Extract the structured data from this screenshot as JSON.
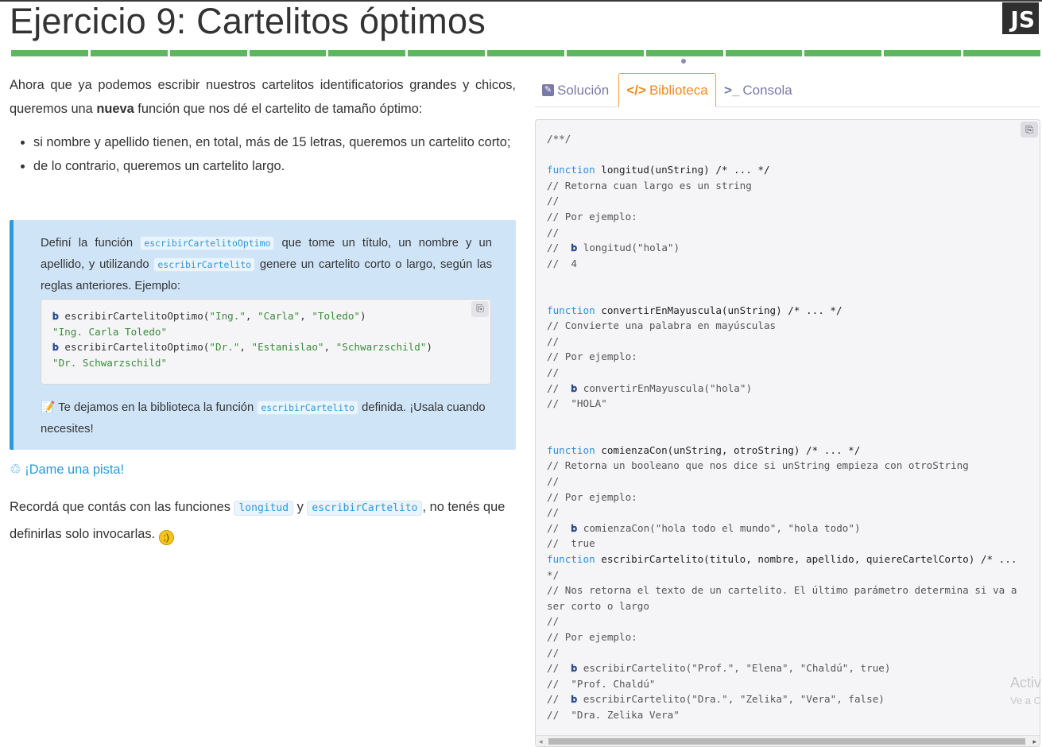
{
  "header": {
    "title": "Ejercicio 9: Cartelitos óptimos",
    "badge": "JS",
    "progress_segments": 13
  },
  "statement": {
    "intro_before": "Ahora que ya podemos escribir nuestros cartelitos identificatorios grandes y chicos, queremos una ",
    "intro_bold": "nueva",
    "intro_after": " función que nos dé el cartelito de tamaño óptimo:",
    "bullets": [
      "si nombre y apellido tienen, en total, más de 15 letras, queremos un cartelito corto;",
      "de lo contrario, queremos un cartelito largo."
    ]
  },
  "callout": {
    "t1": "Definí la función ",
    "code1": "escribirCartelitoOptimo",
    "t2": " que tome un título, un nombre y un apellido, y utilizando ",
    "code2": "escribirCartelito",
    "t3": " genere un cartelito corto o largo, según las reglas anteriores. Ejemplo:",
    "example": {
      "l1_fn": "escribirCartelitoOptimo(",
      "l1_a1": "\"Ing.\"",
      "l1_a2": "\"Carla\"",
      "l1_a3": "\"Toledo\"",
      "l2": "\"Ing. Carla Toledo\"",
      "l3_fn": "escribirCartelitoOptimo(",
      "l3_a1": "\"Dr.\"",
      "l3_a2": "\"Estanislao\"",
      "l3_a3": "\"Schwarzschild\"",
      "l4": "\"Dr. Schwarzschild\""
    },
    "note_icon": "memo-icon",
    "note_t1": " Te dejamos en la biblioteca la función ",
    "note_code": "escribirCartelito",
    "note_t2": " definida. ¡Usala cuando necesites!"
  },
  "hint": {
    "label": "¡Dame una pista!"
  },
  "bottom": {
    "t1": "Recordá que contás con las funciones ",
    "code1": "longitud",
    "t2": " y ",
    "code2": "escribirCartelito",
    "t3": ", no tenés que definirlas solo invocarlas. "
  },
  "tabs": {
    "solucion": "Solución",
    "biblioteca": "Biblioteca",
    "consola": "Consola",
    "active": "biblioteca"
  },
  "library_code": [
    {
      "cls": "cm",
      "text": "/**/"
    },
    {
      "cls": "cm",
      "text": ""
    },
    {
      "cls": "fnline",
      "kw": "function",
      "rest": " longitud(unString) /* ... */"
    },
    {
      "cls": "cm",
      "text": "// Retorna cuan largo es un string"
    },
    {
      "cls": "cm",
      "text": "//"
    },
    {
      "cls": "cm",
      "text": "// Por ejemplo:"
    },
    {
      "cls": "cm",
      "text": "//"
    },
    {
      "cls": "prompt",
      "pre": "//  ",
      "text": " longitud(\"hola\")"
    },
    {
      "cls": "cm",
      "text": "//  4"
    },
    {
      "cls": "cm",
      "text": ""
    },
    {
      "cls": "cm",
      "text": ""
    },
    {
      "cls": "fnline",
      "kw": "function",
      "rest": " convertirEnMayuscula(unString) /* ... */"
    },
    {
      "cls": "cm",
      "text": "// Convierte una palabra en mayúsculas"
    },
    {
      "cls": "cm",
      "text": "//"
    },
    {
      "cls": "cm",
      "text": "// Por ejemplo:"
    },
    {
      "cls": "cm",
      "text": "//"
    },
    {
      "cls": "prompt",
      "pre": "//  ",
      "text": " convertirEnMayuscula(\"hola\")"
    },
    {
      "cls": "cm",
      "text": "//  \"HOLA\""
    },
    {
      "cls": "cm",
      "text": ""
    },
    {
      "cls": "cm",
      "text": ""
    },
    {
      "cls": "fnline",
      "kw": "function",
      "rest": " comienzaCon(unString, otroString) /* ... */"
    },
    {
      "cls": "cm",
      "text": "// Retorna un booleano que nos dice si unString empieza con otroString"
    },
    {
      "cls": "cm",
      "text": "//"
    },
    {
      "cls": "cm",
      "text": "// Por ejemplo:"
    },
    {
      "cls": "cm",
      "text": "//"
    },
    {
      "cls": "prompt",
      "pre": "//  ",
      "text": " comienzaCon(\"hola todo el mundo\", \"hola todo\")"
    },
    {
      "cls": "cm",
      "text": "//  true"
    },
    {
      "cls": "fnline",
      "kw": "function",
      "rest": " escribirCartelito(titulo, nombre, apellido, quiereCartelCorto) /* ..."
    },
    {
      "cls": "cm",
      "text": "*/"
    },
    {
      "cls": "cm",
      "text": "// Nos retorna el texto de un cartelito. El último parámetro determina si va a"
    },
    {
      "cls": "cm",
      "text": "ser corto o largo"
    },
    {
      "cls": "cm",
      "text": "//"
    },
    {
      "cls": "cm",
      "text": "// Por ejemplo:"
    },
    {
      "cls": "cm",
      "text": "//"
    },
    {
      "cls": "prompt",
      "pre": "//  ",
      "text": " escribirCartelito(\"Prof.\", \"Elena\", \"Chaldú\", true)"
    },
    {
      "cls": "cm",
      "text": "//  \"Prof. Chaldú\""
    },
    {
      "cls": "prompt",
      "pre": "//  ",
      "text": " escribirCartelito(\"Dra.\", \"Zelika\", \"Vera\", false)"
    },
    {
      "cls": "cm",
      "text": "//  \"Dra. Zelika Vera\""
    }
  ],
  "watermark": {
    "line1": "Activ",
    "line2": "Ve a C"
  },
  "colors": {
    "progress": "#5cb85c",
    "callout_bg": "#cfe4f7",
    "accent_blue": "#2c98de",
    "active_tab": "#f08a1c",
    "tab_text": "#7a7aa8"
  }
}
